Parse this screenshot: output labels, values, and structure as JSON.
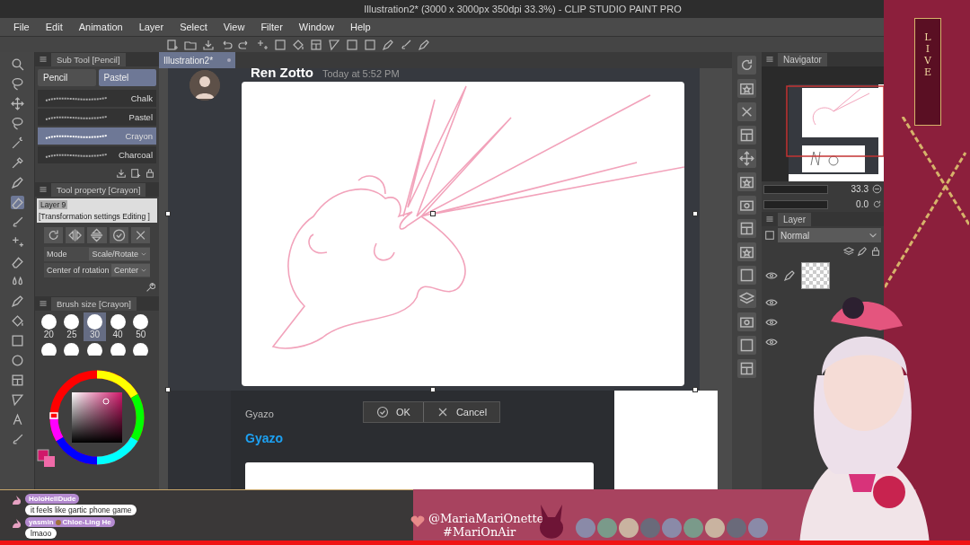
{
  "window": {
    "title": "Illustration2* (3000 x 3000px 350dpi 33.3%) - CLIP STUDIO PAINT PRO"
  },
  "menu": [
    "File",
    "Edit",
    "Animation",
    "Layer",
    "Select",
    "View",
    "Filter",
    "Window",
    "Help"
  ],
  "document_tab": {
    "label": "Illustration2*"
  },
  "sub_tool": {
    "title": "Sub Tool [Pencil]",
    "groups": [
      {
        "label": "Pencil",
        "selected": false
      },
      {
        "label": "Pastel",
        "selected": true
      }
    ],
    "brushes": [
      {
        "label": "Chalk",
        "selected": false
      },
      {
        "label": "Pastel",
        "selected": false
      },
      {
        "label": "Crayon",
        "selected": true
      },
      {
        "label": "Charcoal",
        "selected": false
      }
    ]
  },
  "tool_property": {
    "title": "Tool property [Crayon]",
    "layer": "Layer 9",
    "status": "[Transformation settings Editing ]",
    "mode_label": "Mode",
    "mode": "Scale/Rotate",
    "center_label": "Center of rotation",
    "center": "Center"
  },
  "brush_size": {
    "title": "Brush size [Crayon]",
    "sizes": [
      {
        "label": "20",
        "selected": false
      },
      {
        "label": "25",
        "selected": false
      },
      {
        "label": "30",
        "selected": true
      },
      {
        "label": "40",
        "selected": false
      },
      {
        "label": "50",
        "selected": false
      }
    ]
  },
  "canvas": {
    "author": "Ren Zotto",
    "time": "Today at 5:52 PM",
    "app_label": "Gyazo",
    "app_title": "Gyazo",
    "buttons": [
      "OK",
      "Cancel"
    ]
  },
  "navigator": {
    "title": "Navigator",
    "zoom": "33.3",
    "angle": "0.0"
  },
  "layer_panel": {
    "title": "Layer",
    "blend_mode": "Normal"
  },
  "chat": [
    {
      "name_parts": [
        "HoloHellDude"
      ],
      "message": "it feels like gartic phone game"
    },
    {
      "name_parts": [
        "yasmin",
        "Chloe-Ling He"
      ],
      "message": "lmaoo"
    }
  ],
  "overlay": {
    "handle": "@MariaMariOnette",
    "hashtag": "#MariOnAir",
    "live": "LIVE"
  }
}
